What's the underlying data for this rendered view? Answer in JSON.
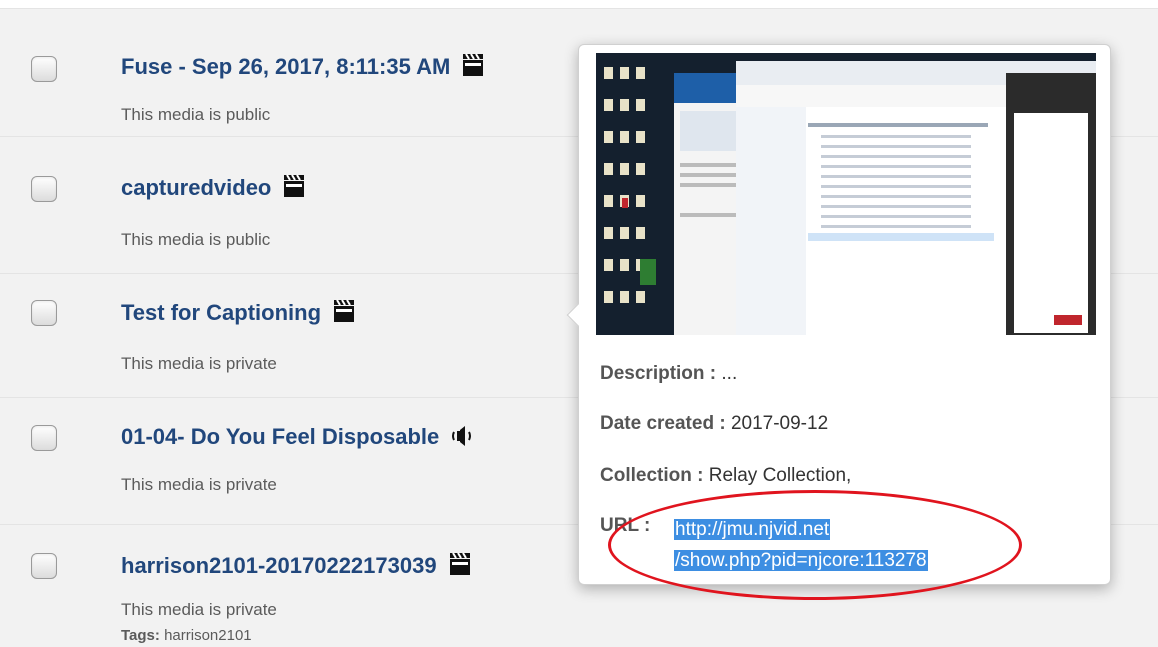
{
  "media_list": [
    {
      "title": "Fuse - Sep 26, 2017, 8:11:35 AM",
      "icon": "film-clapper-icon",
      "status": "This media is public"
    },
    {
      "title": "capturedvideo",
      "icon": "film-clapper-icon",
      "status": "This media is public"
    },
    {
      "title": "Test for Captioning",
      "icon": "film-clapper-icon",
      "status": "This media is private"
    },
    {
      "title": "01-04- Do You Feel Disposable",
      "icon": "audio-speaker-icon",
      "status": "This media is private"
    },
    {
      "title": "harrison2101-20170222173039",
      "icon": "film-clapper-icon",
      "status": "This media is private",
      "tags_label": "Tags:",
      "tags_value": "harrison2101"
    }
  ],
  "popover": {
    "description_label": "Description :",
    "description_value": "...",
    "date_label": "Date created :",
    "date_value": "2017-09-12",
    "collection_label": "Collection :",
    "collection_value": "Relay Collection,",
    "url_label": "URL :",
    "url_line1": "http://jmu.njvid.net",
    "url_line2": "/show.php?pid=njcore:113278"
  },
  "colors": {
    "title": "#21477c",
    "url_selection": "#3d8ee2",
    "annotation": "#e0141e"
  }
}
